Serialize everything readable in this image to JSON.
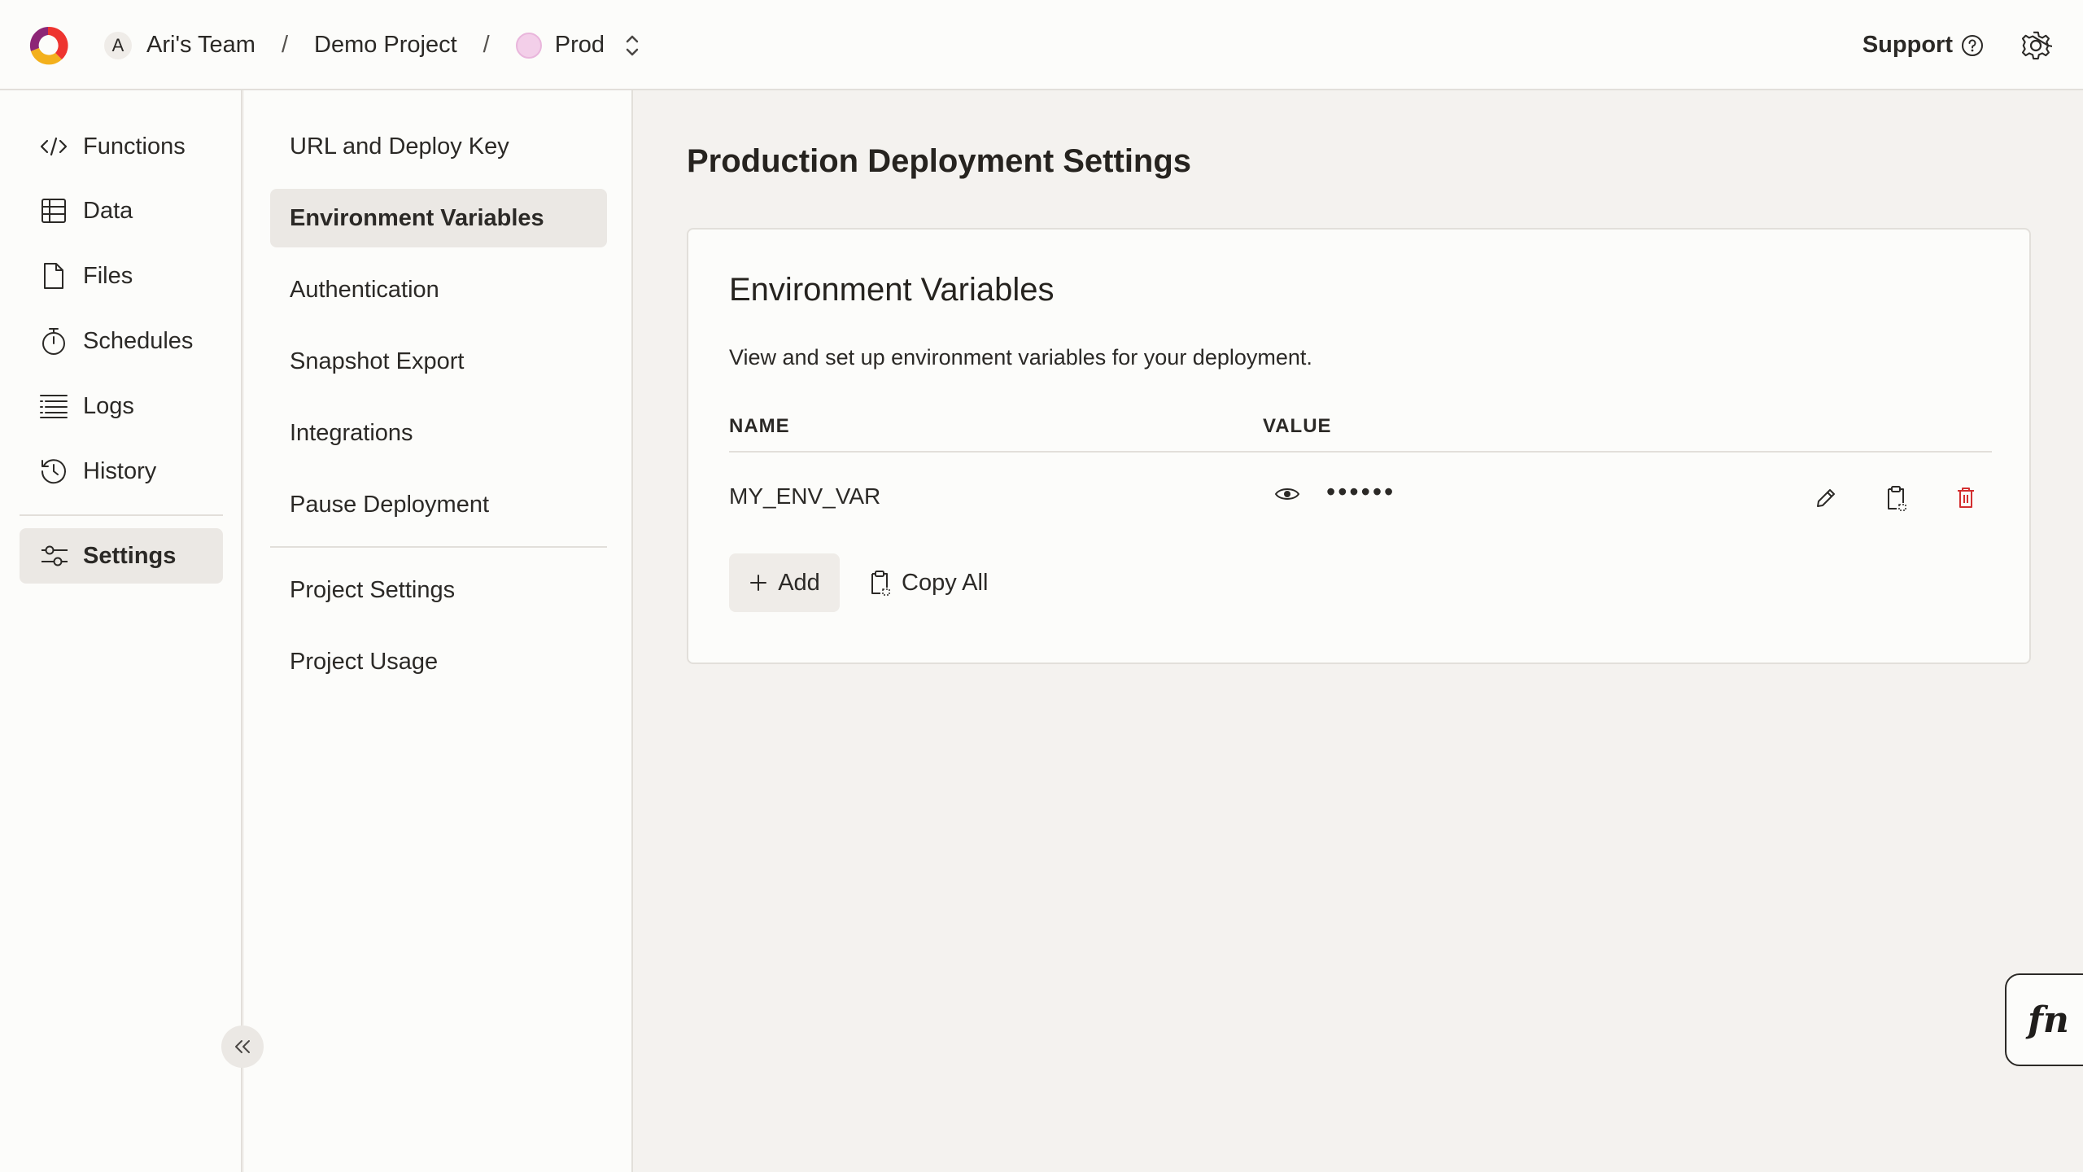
{
  "header": {
    "team_avatar": "A",
    "team": "Ari's Team",
    "separator": "/",
    "project": "Demo Project",
    "deployment": "Prod",
    "support": "Support"
  },
  "sidebar": {
    "items": [
      {
        "label": "Functions",
        "icon": "code-icon"
      },
      {
        "label": "Data",
        "icon": "table-icon"
      },
      {
        "label": "Files",
        "icon": "file-icon"
      },
      {
        "label": "Schedules",
        "icon": "stopwatch-icon"
      },
      {
        "label": "Logs",
        "icon": "list-icon"
      },
      {
        "label": "History",
        "icon": "history-icon"
      },
      {
        "label": "Settings",
        "icon": "sliders-icon",
        "active": true
      }
    ]
  },
  "settings_nav": {
    "items": [
      {
        "label": "URL and Deploy Key"
      },
      {
        "label": "Environment Variables",
        "active": true
      },
      {
        "label": "Authentication"
      },
      {
        "label": "Snapshot Export"
      },
      {
        "label": "Integrations"
      },
      {
        "label": "Pause Deployment"
      }
    ],
    "project_items": [
      {
        "label": "Project Settings"
      },
      {
        "label": "Project Usage"
      }
    ]
  },
  "main": {
    "title": "Production Deployment Settings",
    "card": {
      "title": "Environment Variables",
      "description": "View and set up environment variables for your deployment.",
      "columns": [
        "NAME",
        "VALUE"
      ],
      "rows": [
        {
          "name": "MY_ENV_VAR",
          "value_masked": "••••••"
        }
      ],
      "add_label": "Add",
      "copy_all_label": "Copy All"
    }
  },
  "fn_button": "fn",
  "colors": {
    "accent_delete": "#d32f2f",
    "active_bg": "#ebe8e4",
    "prod_dot": "#f3cfe9"
  }
}
